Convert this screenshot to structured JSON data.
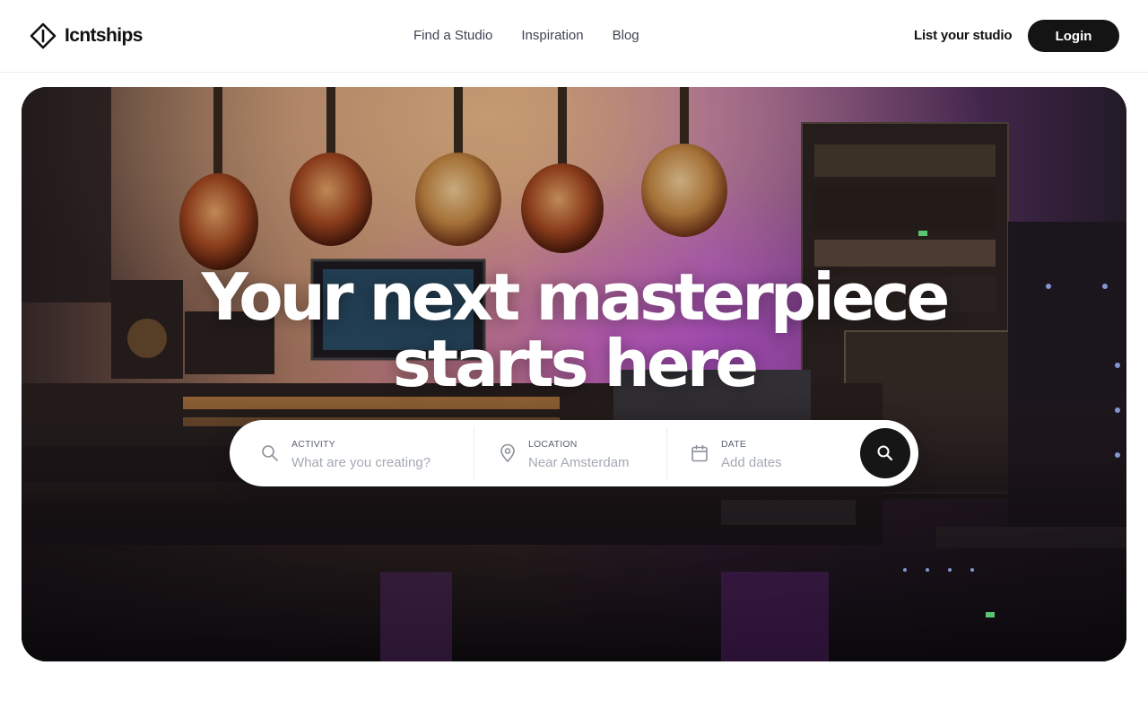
{
  "brand": {
    "name": "Icntships",
    "logo_icon": "diamond-logo-icon"
  },
  "nav": {
    "links": [
      "Find a Studio",
      "Inspiration",
      "Blog"
    ],
    "list_studio": "List your studio",
    "login": "Login"
  },
  "hero": {
    "title_line1": "Your next masterpiece",
    "title_line2": "starts here",
    "background": "recording-studio-photo"
  },
  "search": {
    "activity": {
      "label": "ACTIVITY",
      "placeholder": "What are you creating?",
      "icon": "search-icon"
    },
    "location": {
      "label": "LOCATION",
      "placeholder": "Near Amsterdam",
      "icon": "map-pin-icon"
    },
    "date": {
      "label": "DATE",
      "placeholder": "Add dates",
      "icon": "calendar-icon"
    },
    "submit_icon": "search-icon"
  },
  "colors": {
    "primary_button": "#141414",
    "text": "#111111",
    "nav_text": "#3d4452",
    "placeholder": "#a4a9b3"
  }
}
